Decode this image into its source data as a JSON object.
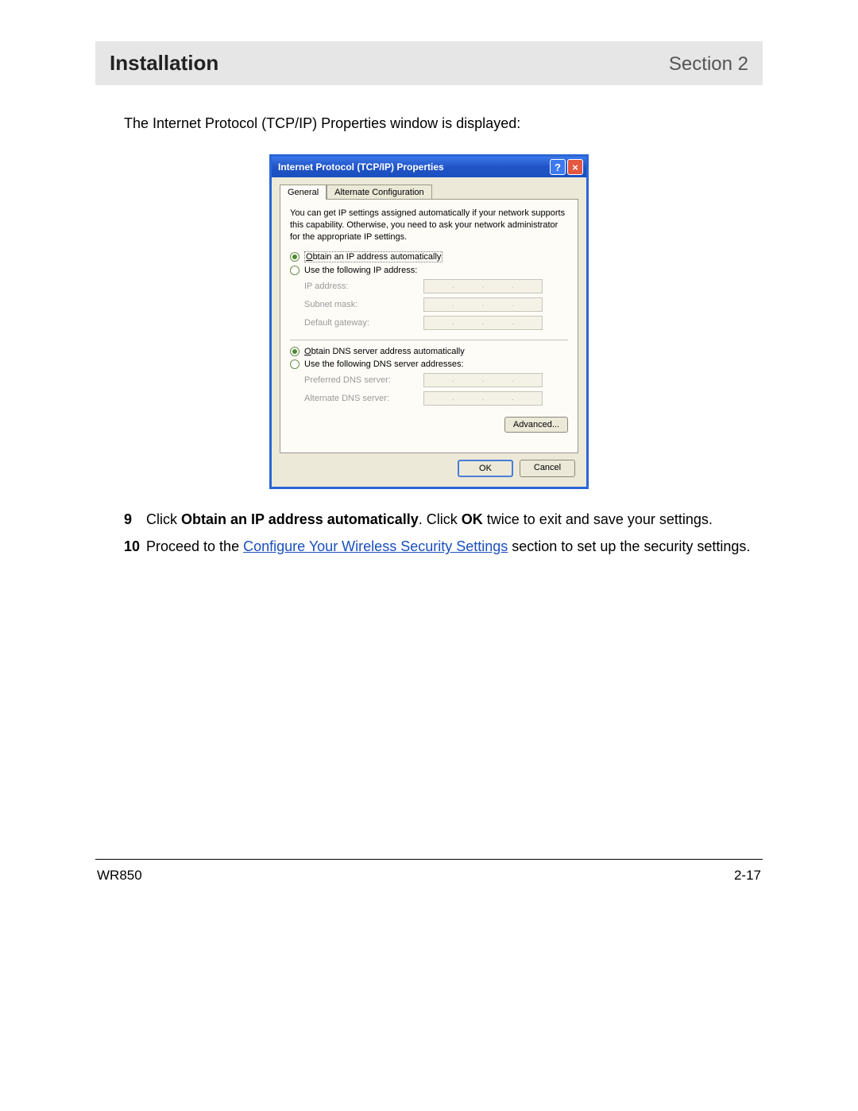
{
  "header": {
    "left": "Installation",
    "right": "Section 2"
  },
  "intro": "The Internet Protocol (TCP/IP) Properties window is displayed:",
  "dialog": {
    "title": "Internet Protocol (TCP/IP) Properties",
    "help_btn": "?",
    "close_btn": "×",
    "tabs": {
      "general": "General",
      "alt": "Alternate Configuration"
    },
    "desc": "You can get IP settings assigned automatically if your network supports this capability. Otherwise, you need to ask your network administrator for the appropriate IP settings.",
    "radio_ip_auto_pre": "O",
    "radio_ip_auto_rest": "btain an IP address automatically",
    "radio_ip_manual_pre": "Use the following IP address:",
    "fields": {
      "ip": "IP address:",
      "subnet": "Subnet mask:",
      "gateway": "Default gateway:",
      "pref_dns": "Preferred DNS server:",
      "alt_dns": "Alternate DNS server:"
    },
    "radio_dns_auto_pre": "O",
    "radio_dns_auto_rest": "btain DNS server address automatically",
    "radio_dns_manual": "Use the following DNS server addresses:",
    "advanced": "Advanced...",
    "ok": "OK",
    "cancel": "Cancel"
  },
  "steps": {
    "s9": {
      "num": "9",
      "pre": "Click ",
      "b1": "Obtain an IP address automatically",
      "mid": ". Click ",
      "b2": "OK",
      "post": " twice to exit and save your settings."
    },
    "s10": {
      "num": "10",
      "pre": "Proceed to the ",
      "link": "Configure Your Wireless Security Settings",
      "post": " section to set up the security settings."
    }
  },
  "footer": {
    "left": "WR850",
    "right": "2-17"
  }
}
